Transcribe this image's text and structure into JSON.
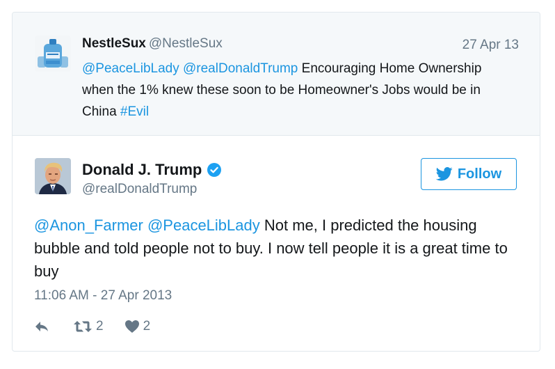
{
  "parent_tweet": {
    "author_name": "NestleSux",
    "author_handle": "@NestleSux",
    "date": "27 Apr 13",
    "mention1": "@PeaceLibLady",
    "mention2": "@realDonaldTrump",
    "text_part1": " Encouraging Home Ownership when the 1% knew these soon to be Homeowner's Jobs would be in China ",
    "hashtag": "#Evil",
    "avatar_icon": "water-jugs-avatar"
  },
  "tweet": {
    "author_name": "Donald J. Trump",
    "author_handle": "@realDonaldTrump",
    "verified_icon": "verified-badge-icon",
    "follow_label": "Follow",
    "mention1": "@Anon_Farmer",
    "mention2": "@PeaceLibLady",
    "text_part1": " Not me, I predicted the housing bubble and told people not to buy. I now tell people it is a great time to buy",
    "timestamp": "11:06 AM - 27 Apr 2013",
    "retweet_count": "2",
    "like_count": "2",
    "avatar_icon": "profile-photo-avatar"
  },
  "colors": {
    "link": "#1b95e0",
    "secondary_text": "#657786",
    "parent_background": "#f5f8fa",
    "border": "#e1e8ed"
  }
}
